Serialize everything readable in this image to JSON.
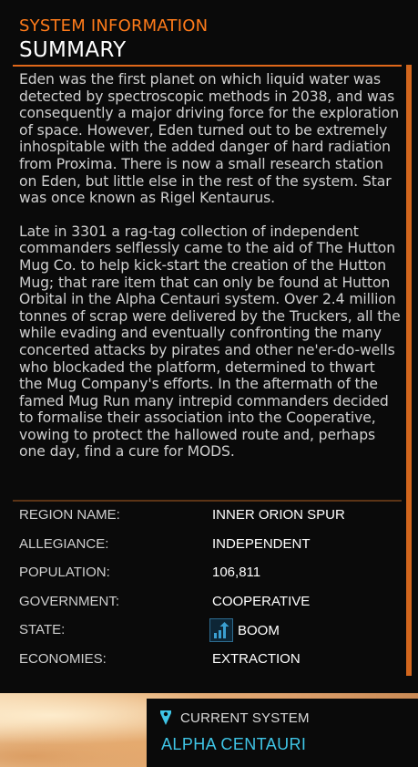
{
  "header": {
    "section": "SYSTEM INFORMATION",
    "title": "SUMMARY"
  },
  "summary": {
    "paragraphs": [
      "Eden was the first planet on which liquid water was detected by spectroscopic methods in 2038, and was consequently a major driving force for the exploration of space. However, Eden turned out to be extremely inhospitable with the added danger of hard radiation from Proxima. There is now a small research station on Eden, but little else in the rest of the system. Star was once known as Rigel Kentaurus.",
      "Late in 3301 a rag-tag collection of independent commanders selflessly came to the aid of The Hutton Mug Co. to help kick-start the creation of the Hutton Mug; that rare item that can only be found at Hutton Orbital in the Alpha Centauri system. Over 2.4 million tonnes of scrap were delivered by the Truckers, all the while evading and eventually confronting the many concerted attacks by pirates and other ne'er-do-wells who blockaded the platform, determined to thwart the Mug Company's efforts. In the aftermath of the famed Mug Run many intrepid commanders decided to formalise their association into the Cooperative, vowing to protect the hallowed route and, perhaps one day, find a cure for MODS."
    ]
  },
  "info": {
    "rows": [
      {
        "label": "REGION NAME:",
        "value": "INNER ORION SPUR"
      },
      {
        "label": "ALLEGIANCE:",
        "value": "INDEPENDENT"
      },
      {
        "label": "POPULATION:",
        "value": "106,811"
      },
      {
        "label": "GOVERNMENT:",
        "value": "COOPERATIVE"
      },
      {
        "label": "STATE:",
        "value": "BOOM",
        "icon": "boom-chart-icon"
      },
      {
        "label": "ECONOMIES:",
        "value": "EXTRACTION"
      }
    ]
  },
  "current_system": {
    "icon": "location-marker-icon",
    "label": "CURRENT SYSTEM",
    "name": "ALPHA CENTAURI"
  },
  "colors": {
    "accent_orange": "#ff7b1a",
    "accent_cyan": "#3fc5e6",
    "background": "#0a0a0a"
  }
}
